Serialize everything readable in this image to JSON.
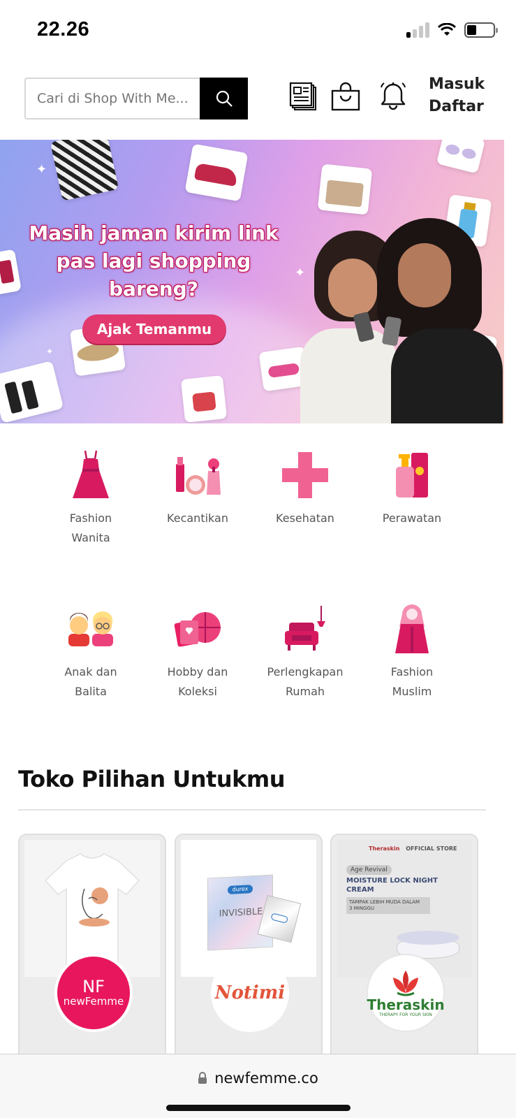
{
  "status": {
    "time": "22.26"
  },
  "header": {
    "search_placeholder": "Cari di Shop With Me...",
    "login": "Masuk",
    "register": "Daftar"
  },
  "banner": {
    "headline_line1": "Masih jaman kirim link",
    "headline_line2": "pas lagi shopping",
    "headline_line3": "bareng?",
    "cta": "Ajak Temanmu"
  },
  "categories": [
    {
      "line1": "Fashion",
      "line2": "Wanita",
      "icon": "dress-icon"
    },
    {
      "line1": "Kecantikan",
      "line2": "",
      "icon": "cosmetics-icon"
    },
    {
      "line1": "Kesehatan",
      "line2": "",
      "icon": "health-cross-icon"
    },
    {
      "line1": "Perawatan",
      "line2": "",
      "icon": "skincare-icon"
    },
    {
      "line1": "Anak dan",
      "line2": "Balita",
      "icon": "kids-icon"
    },
    {
      "line1": "Hobby dan",
      "line2": "Koleksi",
      "icon": "hobby-icon"
    },
    {
      "line1": "Perlengkapan",
      "line2": "Rumah",
      "icon": "armchair-icon"
    },
    {
      "line1": "Fashion",
      "line2": "Muslim",
      "icon": "hijab-icon"
    }
  ],
  "section": {
    "title": "Toko Pilihan Untukmu"
  },
  "stores": [
    {
      "logo_top": "NF",
      "logo_bottom": "newFemme"
    },
    {
      "logo": "Notimi",
      "product": "INVISIBLE",
      "brand": "durex"
    },
    {
      "brand_header": "Theraskin",
      "official": "OFFICIAL STORE",
      "tag": "Age Revival",
      "product_line1": "MOISTURE LOCK NIGHT",
      "product_line2": "CREAM",
      "claim_line1": "TAMPAK LEBIH MUDA DALAM",
      "claim_line2": "3 MINGGU",
      "logo": "Theraskin",
      "tagline": "THERAPY FOR YOUR SKIN"
    }
  ],
  "browser": {
    "url": "newfemme.co"
  },
  "colors": {
    "accent": "#e23a6e",
    "brand_pink": "#e8175d"
  }
}
